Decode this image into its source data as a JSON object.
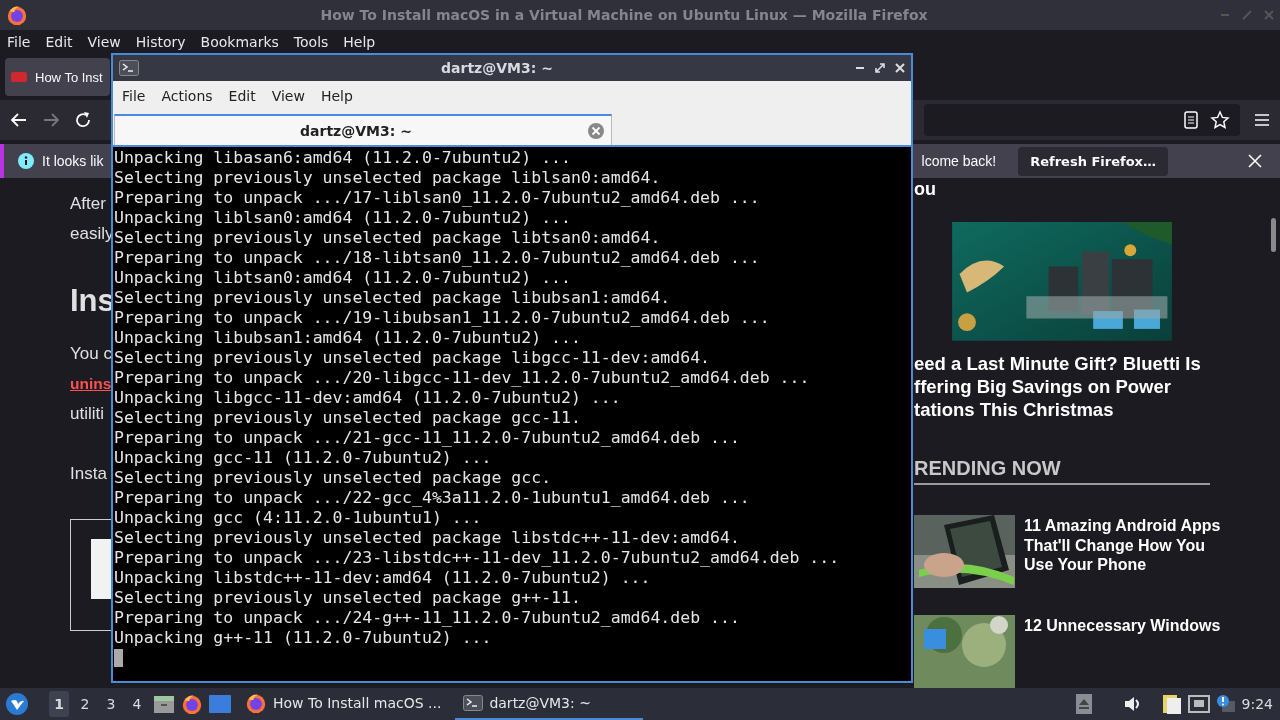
{
  "browser": {
    "title": "How To Install macOS in a Virtual Machine on Ubuntu Linux — Mozilla Firefox",
    "menu": [
      "File",
      "Edit",
      "View",
      "History",
      "Bookmarks",
      "Tools",
      "Help"
    ],
    "tabs": [
      {
        "label": "How To Inst",
        "selected": true
      }
    ],
    "notification": {
      "text": "It looks lik",
      "text_end": "lcome back!",
      "button": "Refresh Firefox…"
    },
    "article": [
      {
        "kind": "paragraph",
        "lines": [
          {
            "text": "After",
            "link": false
          },
          {
            "text": "easily",
            "link": false
          }
        ]
      },
      {
        "kind": "heading",
        "text": "Ins"
      },
      {
        "kind": "paragraph",
        "lines": [
          {
            "text": "You c",
            "link": false
          },
          {
            "text": "unins",
            "link": true
          },
          {
            "text": "utiliti",
            "link": false
          }
        ]
      },
      {
        "kind": "paragraph",
        "lines": [
          {
            "text": "Insta",
            "link": false
          }
        ]
      },
      {
        "kind": "embed"
      }
    ],
    "sidebar": {
      "heading_tail": "ou",
      "ad": {
        "kind": "picture"
      },
      "headline_lines": [
        "eed a Last Minute Gift? Bluetti Is",
        "ffering Big Savings on Power",
        "tations This Christmas"
      ],
      "section_title": "RENDING NOW",
      "trending": [
        {
          "kind": "phone",
          "title_lines": [
            "11 Amazing Android Apps",
            "That'll Change How You",
            "Use Your Phone"
          ]
        },
        {
          "kind": "plant",
          "title_lines": [
            "12 Unnecessary Windows"
          ]
        }
      ]
    }
  },
  "terminal": {
    "title": "dartz@VM3: ~",
    "menu": [
      "File",
      "Actions",
      "Edit",
      "View",
      "Help"
    ],
    "tabs": [
      {
        "label": "dartz@VM3: ~",
        "selected": true
      }
    ],
    "lines": [
      "Unpacking libasan6:amd64 (11.2.0-7ubuntu2) ...",
      "Selecting previously unselected package liblsan0:amd64.",
      "Preparing to unpack .../17-liblsan0_11.2.0-7ubuntu2_amd64.deb ...",
      "Unpacking liblsan0:amd64 (11.2.0-7ubuntu2) ...",
      "Selecting previously unselected package libtsan0:amd64.",
      "Preparing to unpack .../18-libtsan0_11.2.0-7ubuntu2_amd64.deb ...",
      "Unpacking libtsan0:amd64 (11.2.0-7ubuntu2) ...",
      "Selecting previously unselected package libubsan1:amd64.",
      "Preparing to unpack .../19-libubsan1_11.2.0-7ubuntu2_amd64.deb ...",
      "Unpacking libubsan1:amd64 (11.2.0-7ubuntu2) ...",
      "Selecting previously unselected package libgcc-11-dev:amd64.",
      "Preparing to unpack .../20-libgcc-11-dev_11.2.0-7ubuntu2_amd64.deb ...",
      "Unpacking libgcc-11-dev:amd64 (11.2.0-7ubuntu2) ...",
      "Selecting previously unselected package gcc-11.",
      "Preparing to unpack .../21-gcc-11_11.2.0-7ubuntu2_amd64.deb ...",
      "Unpacking gcc-11 (11.2.0-7ubuntu2) ...",
      "Selecting previously unselected package gcc.",
      "Preparing to unpack .../22-gcc_4%3a11.2.0-1ubuntu1_amd64.deb ...",
      "Unpacking gcc (4:11.2.0-1ubuntu1) ...",
      "Selecting previously unselected package libstdc++-11-dev:amd64.",
      "Preparing to unpack .../23-libstdc++-11-dev_11.2.0-7ubuntu2_amd64.deb ...",
      "Unpacking libstdc++-11-dev:amd64 (11.2.0-7ubuntu2) ...",
      "Selecting previously unselected package g++-11.",
      "Preparing to unpack .../24-g++-11_11.2.0-7ubuntu2_amd64.deb ...",
      "Unpacking g++-11 (11.2.0-7ubuntu2) ..."
    ]
  },
  "taskbar": {
    "workspaces": [
      {
        "label": "1",
        "selected": true
      },
      {
        "label": "2",
        "selected": false
      },
      {
        "label": "3",
        "selected": false
      },
      {
        "label": "4",
        "selected": false
      }
    ],
    "tasks": [
      {
        "kind": "browser",
        "label": "How To Install macOS ...",
        "selected": false
      },
      {
        "kind": "terminal",
        "label": "dartz@VM3: ~",
        "selected": true
      }
    ],
    "clock": "9:24"
  }
}
